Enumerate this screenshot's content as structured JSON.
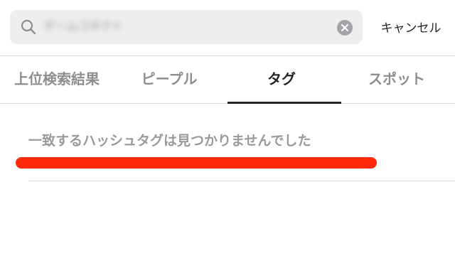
{
  "search": {
    "value": "ゲームコネクト",
    "cancel_label": "キャンセル"
  },
  "tabs": [
    {
      "label": "上位検索結果",
      "active": false
    },
    {
      "label": "ピープル",
      "active": false
    },
    {
      "label": "タグ",
      "active": true
    },
    {
      "label": "スポット",
      "active": false
    }
  ],
  "results": {
    "empty_message": "一致するハッシュタグは見つかりませんでした"
  },
  "colors": {
    "annotation_underline": "#ff2a0a",
    "active_tab": "#262626",
    "inactive_tab": "#8e8e8e"
  },
  "icons": {
    "search": "search-icon",
    "clear": "clear-icon"
  }
}
